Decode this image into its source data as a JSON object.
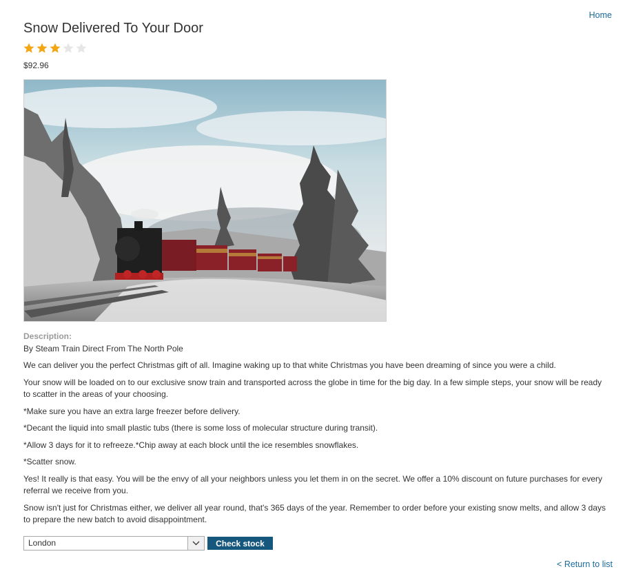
{
  "header": {
    "home_label": "Home"
  },
  "product": {
    "title": "Snow Delivered To Your Door",
    "rating": 3,
    "rating_max": 5,
    "price": "$92.96"
  },
  "colors": {
    "link": "#1a6a9a",
    "star_filled": "#f2a614",
    "star_empty": "#e6e6e6",
    "button": "#15577d"
  },
  "description": {
    "label": "Description:",
    "subtitle": "By Steam Train Direct From The North Pole",
    "paragraphs": [
      "We can deliver you the perfect Christmas gift of all. Imagine waking up to that white Christmas you have been dreaming of since you were a child.",
      "Your snow will be loaded on to our exclusive snow train and transported across the globe in time for the big day. In a few simple steps, your snow will be ready to scatter in the areas of your choosing.",
      "*Make sure you have an extra large freezer before delivery.",
      "*Decant the liquid into small plastic tubs (there is some loss of molecular structure during transit).",
      "*Allow 3 days for it to refreeze.*Chip away at each block until the ice resembles snowflakes.",
      "*Scatter snow.",
      "Yes! It really is that easy. You will be the envy of all your neighbors unless you let them in on the secret. We offer a 10% discount on future purchases for every referral we receive from you.",
      "Snow isn't just for Christmas either, we deliver all year round, that's 365 days of the year. Remember to order before your existing snow melts, and allow 3 days to prepare the new batch to avoid disappointment."
    ]
  },
  "stock_form": {
    "selected_city": "London",
    "button_label": "Check stock"
  },
  "footer": {
    "return_label": "< Return to list"
  }
}
